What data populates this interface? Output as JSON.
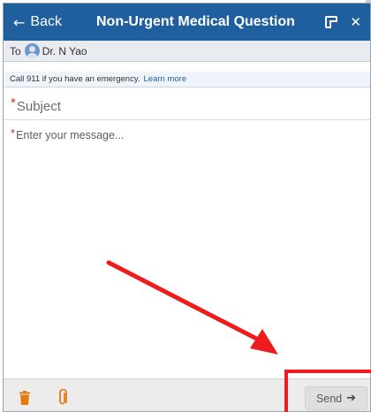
{
  "header": {
    "back_label": "Back",
    "title": "Non-Urgent Medical Question"
  },
  "recipient": {
    "to_label": "To",
    "name": "Dr. N Yao"
  },
  "notice": {
    "text": "Call 911 if you have an emergency.",
    "link": "Learn more"
  },
  "form": {
    "subject_placeholder": "Subject",
    "message_placeholder": "Enter your message...",
    "required_mark": "*"
  },
  "footer": {
    "send_label": "Send"
  },
  "icons": {
    "back": "arrow-left-icon",
    "popout": "popout-icon",
    "close": "close-icon",
    "trash": "trash-icon",
    "attach": "paperclip-icon",
    "send": "send-arrow-icon"
  },
  "colors": {
    "header_bg": "#1f5f9e",
    "required": "#c0392b",
    "trash": "#e07b15",
    "annotation": "#ee1c1c"
  }
}
